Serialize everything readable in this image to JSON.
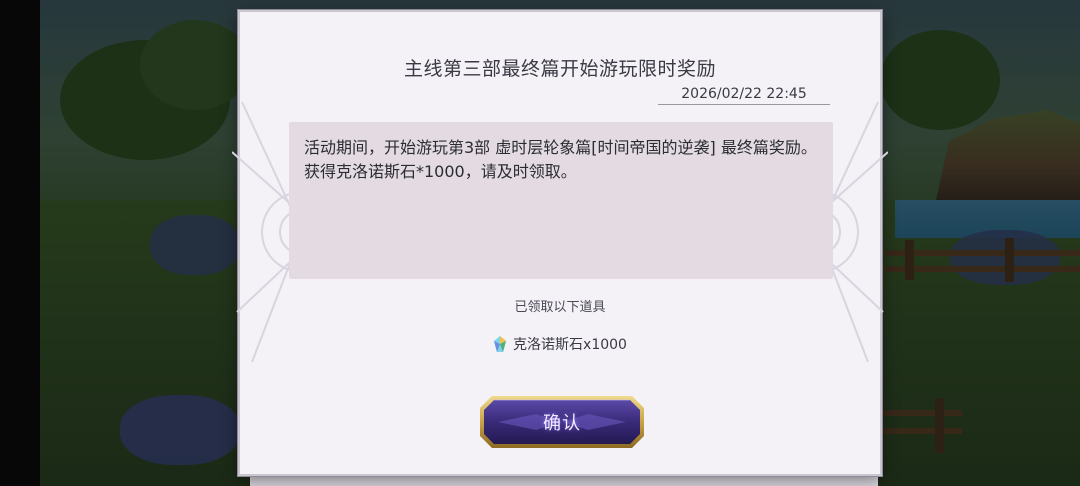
{
  "dialog": {
    "title": "主线第三部最终篇开始游玩限时奖励",
    "date": "2026/02/22 22:45",
    "message": {
      "line1": "活动期间，开始游玩第3部 虚时层轮象篇[时间帝国的逆袭] 最终篇奖励。",
      "line2": "获得克洛诺斯石*1000，请及时领取。"
    },
    "received_label": "已领取以下道具",
    "reward": {
      "icon": "chronos-stone-icon",
      "label": "克洛诺斯石x1000"
    },
    "confirm_label": "确认"
  },
  "colors": {
    "dialog_bg": "#f4f2f7",
    "message_bg": "#e3dbe1",
    "button_gold": "#c8a24a",
    "button_purple": "#3a2a78"
  }
}
